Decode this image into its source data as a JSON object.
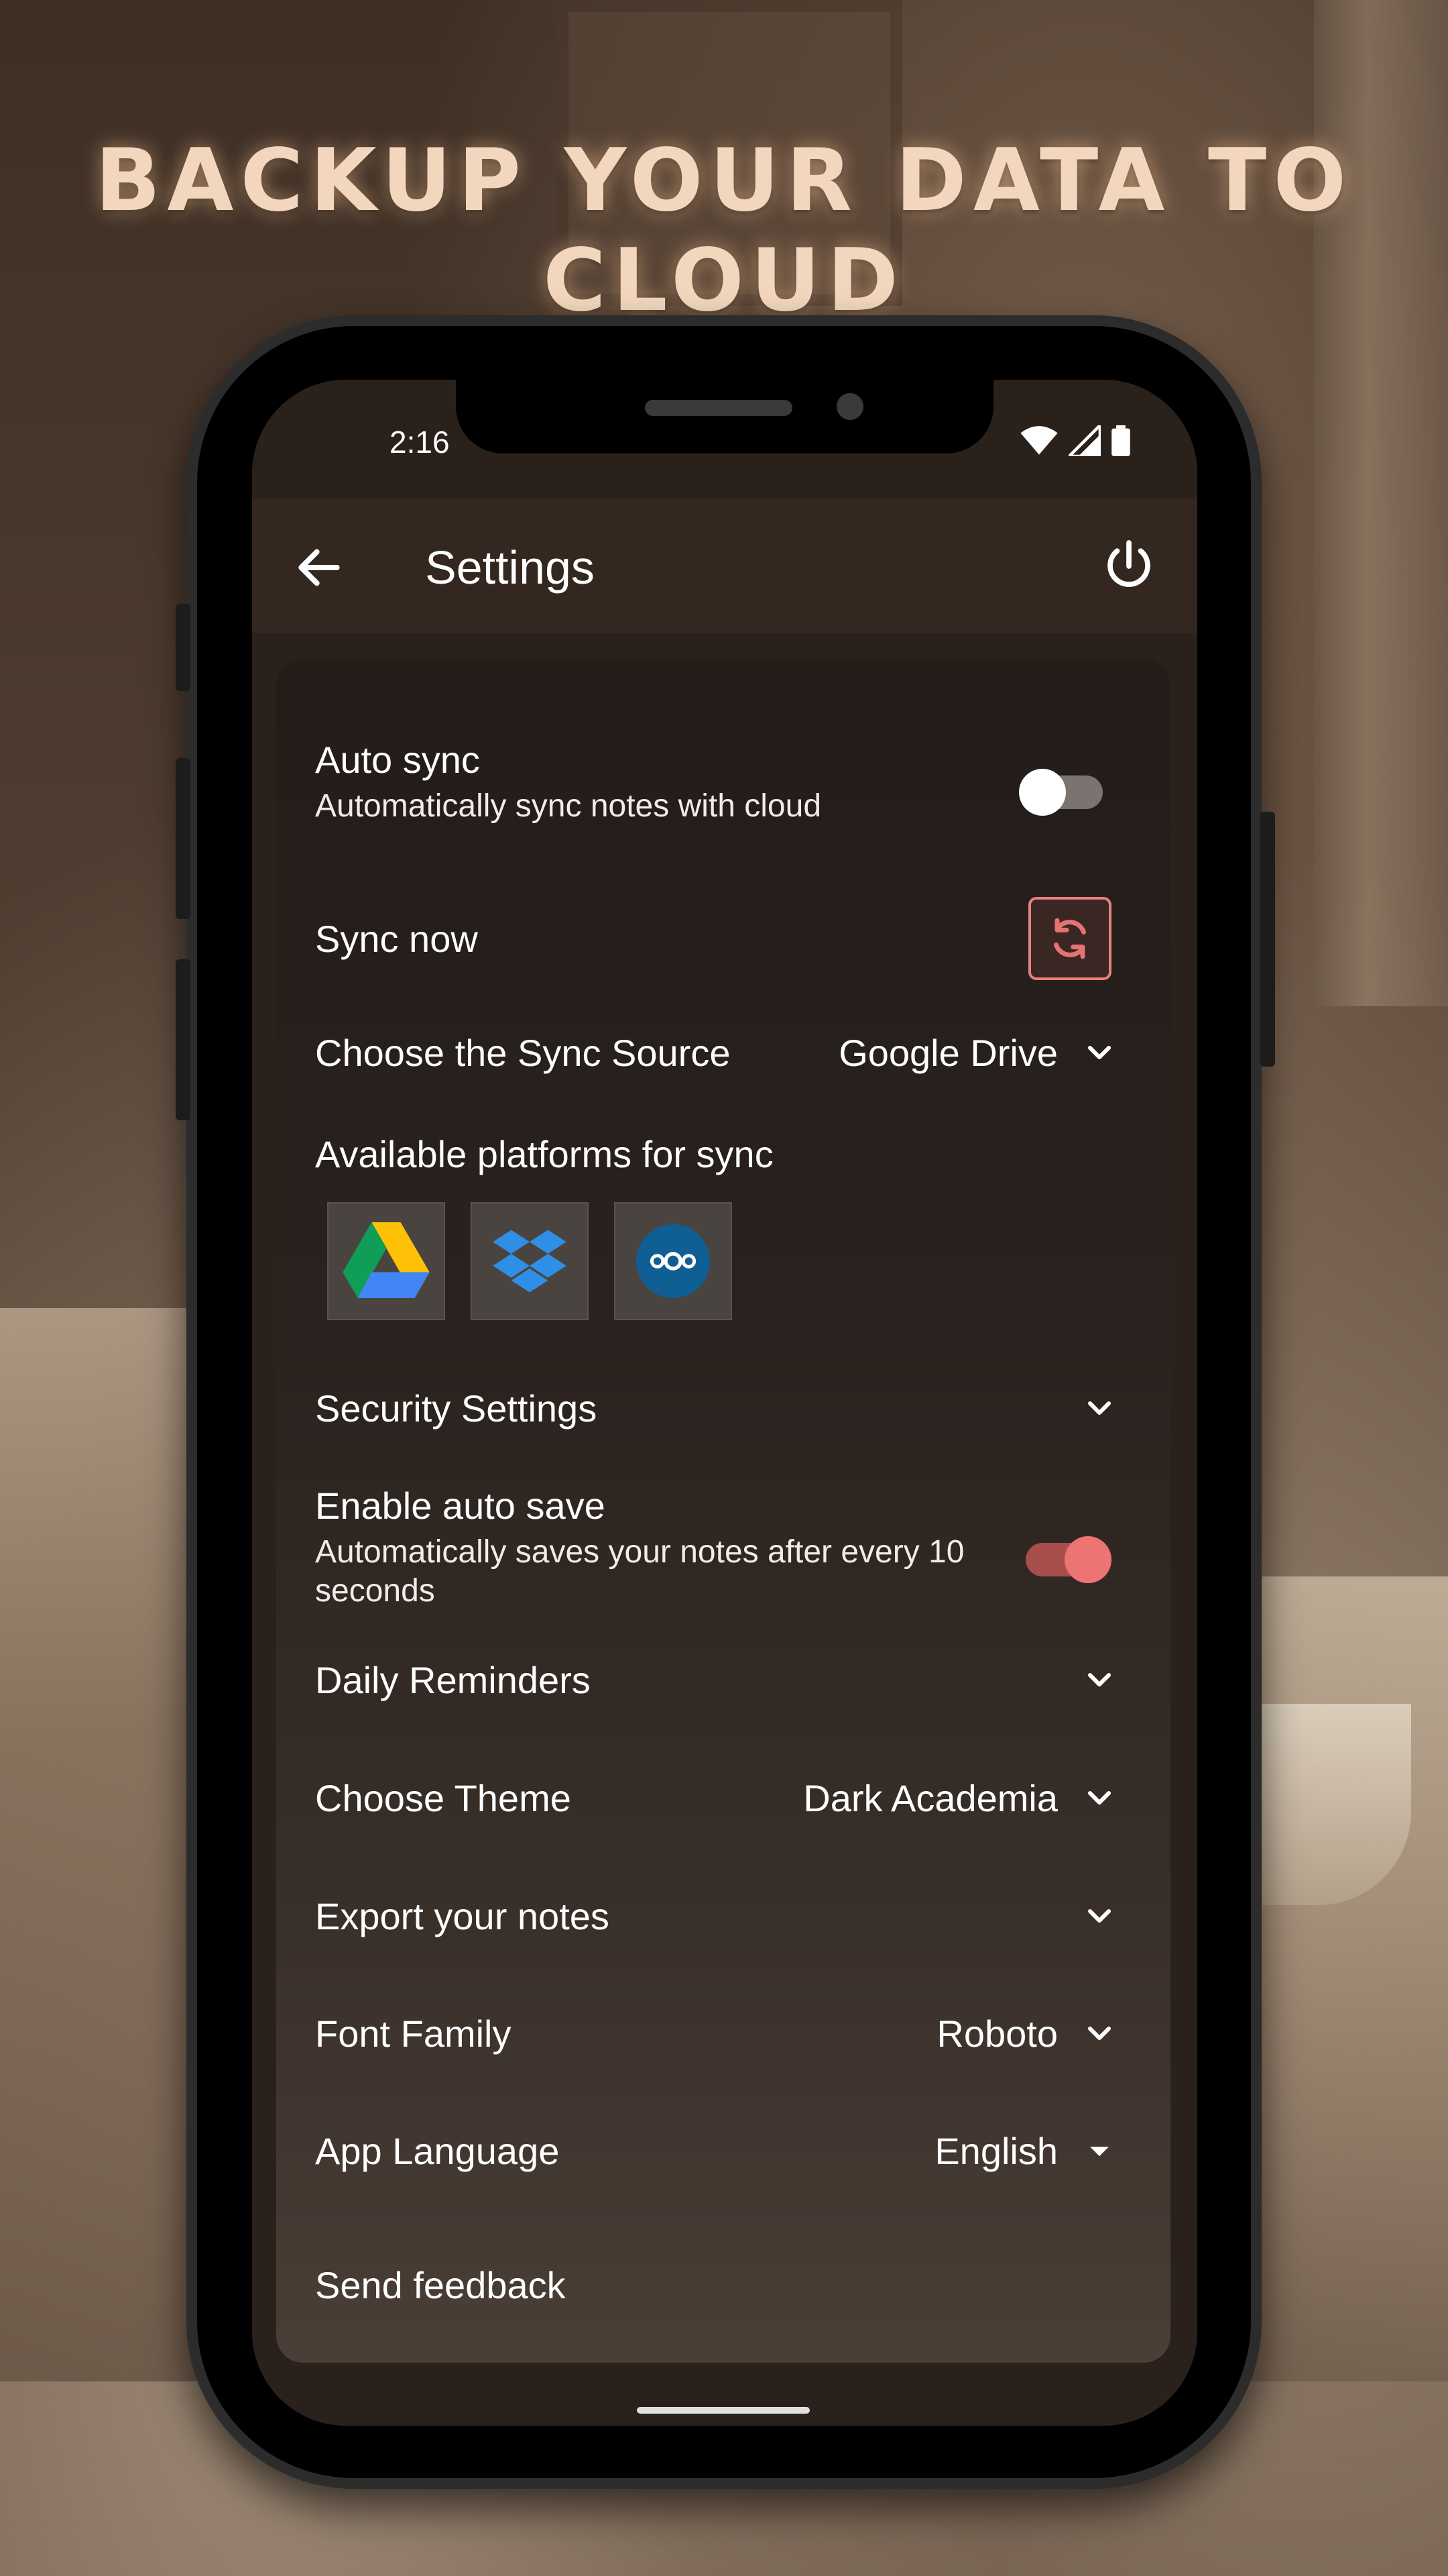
{
  "headline": "BACKUP YOUR DATA TO CLOUD",
  "status_bar": {
    "time": "2:16"
  },
  "app_bar": {
    "title": "Settings"
  },
  "settings": {
    "auto_sync": {
      "title": "Auto sync",
      "subtitle": "Automatically sync notes with cloud",
      "enabled": false
    },
    "sync_now": {
      "title": "Sync now"
    },
    "sync_source": {
      "title": "Choose the Sync Source",
      "value": "Google Drive"
    },
    "platforms": {
      "title": "Available platforms for sync",
      "items": [
        "google-drive-icon",
        "dropbox-icon",
        "nextcloud-icon"
      ]
    },
    "security": {
      "title": "Security Settings"
    },
    "auto_save": {
      "title": "Enable auto save",
      "subtitle": "Automatically saves your notes after every 10 seconds",
      "enabled": true
    },
    "daily_reminders": {
      "title": "Daily Reminders"
    },
    "theme": {
      "title": "Choose Theme",
      "value": "Dark Academia"
    },
    "export": {
      "title": "Export your notes"
    },
    "font_family": {
      "title": "Font Family",
      "value": "Roboto"
    },
    "app_language": {
      "title": "App Language",
      "value": "English"
    },
    "feedback": {
      "title": "Send feedback"
    }
  },
  "colors": {
    "accent": "#e57373",
    "background": "#2b211c",
    "app_bar": "#33271f",
    "headline": "#f2d6bd"
  }
}
